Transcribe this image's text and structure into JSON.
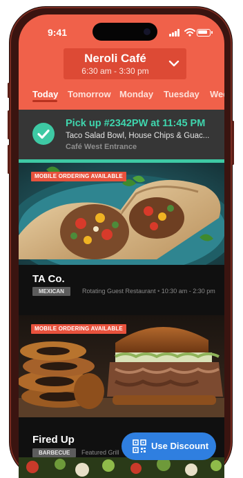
{
  "status": {
    "time": "9:41"
  },
  "cafe": {
    "name": "Neroli Café",
    "hours": "6:30 am - 3:30 pm"
  },
  "tabs": [
    {
      "label": "Today",
      "active": true
    },
    {
      "label": "Tomorrow",
      "active": false
    },
    {
      "label": "Monday",
      "active": false
    },
    {
      "label": "Tuesday",
      "active": false
    },
    {
      "label": "Wedn",
      "active": false
    }
  ],
  "order": {
    "title": "Pick up #2342PW at 11:45 PM",
    "items": "Taco Salad Bowl, House Chips & Guac...",
    "location": "Café West Entrance"
  },
  "restaurants": [
    {
      "badge": "MOBILE ORDERING AVAILABLE",
      "name": "TA Co.",
      "tag": "MEXICAN",
      "type": "Rotating Guest Restaurant",
      "separator": "•",
      "hours": "10:30 am - 2:30 pm"
    },
    {
      "badge": "MOBILE ORDERING AVAILABLE",
      "name": "Fired Up",
      "tag": "BARBECUE",
      "type": "Featured Grill"
    }
  ],
  "discount_button": {
    "label": "Use Discount"
  },
  "colors": {
    "header": "#f0614a",
    "accent_green": "#3ec9a4",
    "badge": "#e8523d",
    "button_blue": "#2f7fe0"
  },
  "icons": [
    "chevron-down-icon",
    "check-icon",
    "qr-code-icon",
    "signal-icon",
    "wifi-icon",
    "battery-icon"
  ]
}
